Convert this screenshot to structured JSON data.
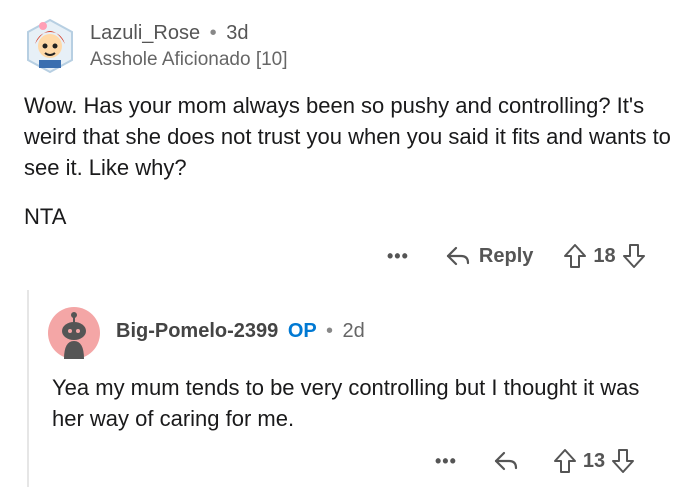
{
  "comment": {
    "username": "Lazuli_Rose",
    "age": "3d",
    "flair": "Asshole Aficionado [10]",
    "body": "Wow. Has your mom always been so pushy and controlling? It's weird that she does not trust you when you said it fits and wants to see it. Like why?",
    "verdict": "NTA",
    "more_label": "•••",
    "reply_label": "Reply",
    "votes": "18"
  },
  "reply": {
    "username": "Big-Pomelo-2399",
    "op_badge": "OP",
    "age": "2d",
    "body": "Yea my mum tends to be very controlling but I thought it was her way of caring for me.",
    "more_label": "•••",
    "votes": "13"
  },
  "separator": "•",
  "colors": {
    "op_blue": "#0079d3",
    "avatar2_bg": "#f4a6a6",
    "meta_gray": "#666666"
  }
}
